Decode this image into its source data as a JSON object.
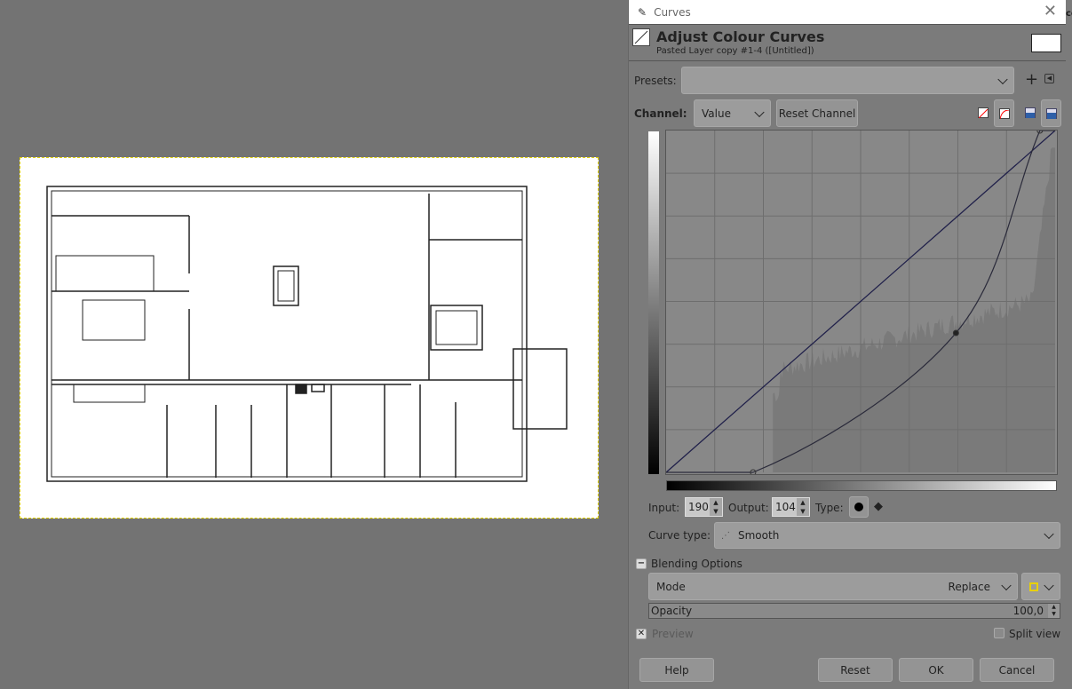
{
  "dialog": {
    "window_title": "Curves",
    "heading": "Adjust Colour Curves",
    "subheading": "Pasted Layer copy #1-4 ([Untitled])",
    "presets_label": "Presets:",
    "presets_value": "",
    "channel_label": "Channel:",
    "channel_value": "Value",
    "reset_channel": "Reset Channel",
    "input_label": "Input:",
    "input_value": "190",
    "output_label": "Output:",
    "output_value": "104",
    "type_label": "Type:",
    "curve_type_label": "Curve type:",
    "curve_type_value": "Smooth",
    "blending_label": "Blending Options",
    "mode_label": "Mode",
    "mode_value": "Replace",
    "opacity_label": "Opacity",
    "opacity_value": "100,0",
    "preview_label": "Preview",
    "preview_checked": true,
    "split_label": "Split view",
    "split_checked": false,
    "buttons": {
      "help": "Help",
      "reset": "Reset",
      "ok": "OK",
      "cancel": "Cancel"
    }
  },
  "curve": {
    "points": [
      [
        57,
        0
      ],
      [
        190,
        104
      ],
      [
        245,
        255
      ]
    ],
    "range": [
      0,
      255
    ],
    "line_color": "#2a2a3a",
    "diag_color": "#20204a"
  },
  "edge_text": "co"
}
